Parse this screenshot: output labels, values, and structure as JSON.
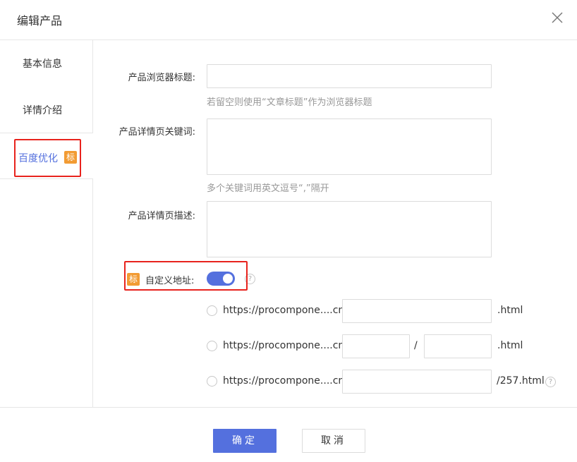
{
  "dialog": {
    "title": "编辑产品"
  },
  "sidebar": {
    "items": [
      {
        "label": "基本信息"
      },
      {
        "label": "详情介绍"
      },
      {
        "label": "百度优化",
        "badge": "标"
      }
    ]
  },
  "form": {
    "browser_title": {
      "label": "产品浏览器标题:",
      "value": "",
      "hint": "若留空则使用“文章标题”作为浏览器标题"
    },
    "keywords": {
      "label": "产品详情页关键词:",
      "value": "",
      "hint": "多个关键词用英文逗号“,”隔开"
    },
    "description": {
      "label": "产品详情页描述:",
      "value": ""
    },
    "custom_url": {
      "badge": "标",
      "label": "自定义地址:",
      "enabled": true,
      "help": "?"
    },
    "url_options": [
      {
        "prefix": "https://procompone....cn/",
        "value": "",
        "suffix": ".html"
      },
      {
        "prefix": "https://procompone....cn/",
        "value1": "",
        "separator": "/",
        "value2": "",
        "suffix": ".html"
      },
      {
        "prefix": "https://procompone....cn/",
        "value": "",
        "suffix": "/257.html",
        "help": "?"
      }
    ]
  },
  "footer": {
    "confirm_label": "确定",
    "cancel_label": "取消"
  },
  "colors": {
    "accent": "#5470de",
    "badge": "#f29b33",
    "highlight": "#e8231d"
  }
}
